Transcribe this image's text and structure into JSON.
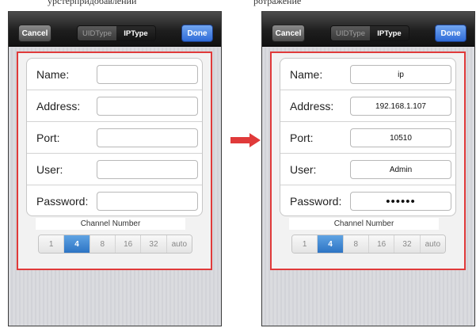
{
  "top_caption": {
    "left": "урстерпридобавлении",
    "right": "ротражение"
  },
  "screens": [
    {
      "nav": {
        "cancel_label": "Cancel",
        "segment": [
          "UIDType",
          "IPType"
        ],
        "selected_segment": "IPType",
        "done_label": "Done"
      },
      "fields": [
        {
          "label": "Name:",
          "value": ""
        },
        {
          "label": "Address:",
          "value": ""
        },
        {
          "label": "Port:",
          "value": ""
        },
        {
          "label": "User:",
          "value": ""
        },
        {
          "label": "Password:",
          "value": ""
        }
      ],
      "channel_label": "Channel Number",
      "channel_options": [
        "1",
        "4",
        "8",
        "16",
        "32",
        "auto"
      ],
      "channel_selected": "4"
    },
    {
      "nav": {
        "cancel_label": "Cancel",
        "segment": [
          "UIDType",
          "IPType"
        ],
        "selected_segment": "IPType",
        "done_label": "Done"
      },
      "fields": [
        {
          "label": "Name:",
          "value": "ip"
        },
        {
          "label": "Address:",
          "value": "192.168.1.107"
        },
        {
          "label": "Port:",
          "value": "10510"
        },
        {
          "label": "User:",
          "value": "Admin"
        },
        {
          "label": "Password:",
          "value": "••••••"
        }
      ],
      "channel_label": "Channel Number",
      "channel_options": [
        "1",
        "4",
        "8",
        "16",
        "32",
        "auto"
      ],
      "channel_selected": "4"
    }
  ],
  "colors": {
    "highlight_border": "#e03a3a",
    "arrow": "#e03a3a",
    "selected_blue": "#2d74c4",
    "done_blue": "#2e6ad8"
  }
}
